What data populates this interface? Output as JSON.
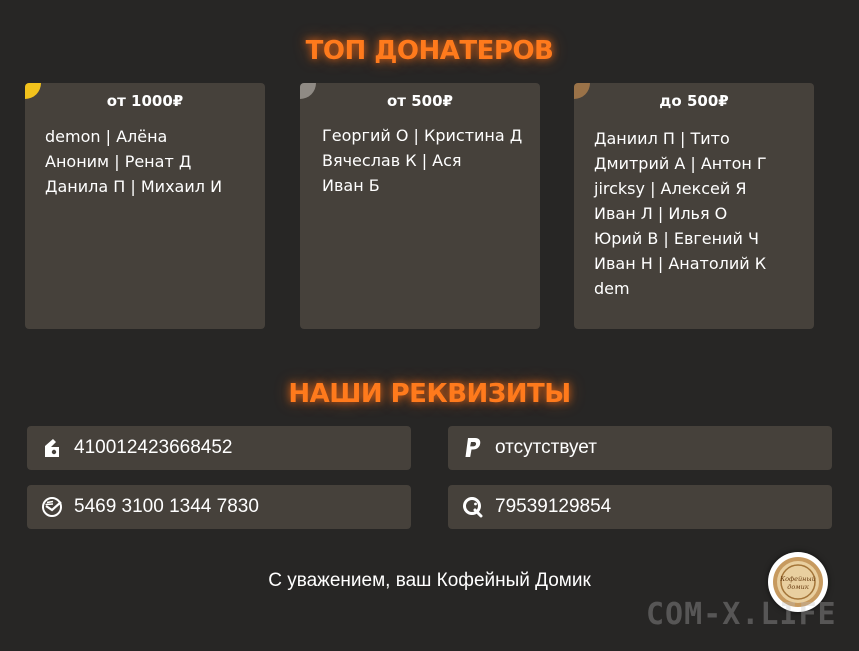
{
  "top_donors": {
    "title": "ТОП ДОНАТЕРОВ",
    "tiers": [
      {
        "title": "от 1000₽",
        "color": "#f2c21c",
        "donors": [
          "demon | Алёна",
          "Аноним | Ренат Д",
          "Данила П | Михаил И"
        ]
      },
      {
        "title": "от 500₽",
        "color": "#8f8a84",
        "donors": [
          "Георгий О | Кристина Д",
          "Вячеслав К | Ася",
          "Иван Б"
        ]
      },
      {
        "title": "до 500₽",
        "color": "#9a7248",
        "donors": [
          "Даниил П | Тито",
          "Дмитрий А | Антон Г",
          "jircksy | Алексей Я",
          "Иван Л | Илья О",
          "Юрий В | Евгений Ч",
          "Иван Н | Анатолий К",
          "dem"
        ]
      }
    ]
  },
  "requisites": {
    "title": "НАШИ РЕКВИЗИТЫ",
    "yoomoney": {
      "icon": "yoomoney-icon",
      "value": "410012423668452"
    },
    "paypal": {
      "icon": "paypal-icon",
      "value": "отсутствует"
    },
    "sberbank": {
      "icon": "sberbank-icon",
      "value": "5469 3100 1344 7830"
    },
    "qiwi": {
      "icon": "qiwi-icon",
      "value": "79539129854"
    }
  },
  "signature": "С уважением, ваш Кофейный Домик",
  "logo_text": "Кофейный домик",
  "watermark": "COM-X.LIFE",
  "colors": {
    "accent": "#ff7a1c",
    "background": "#272625",
    "card": "#46413b"
  }
}
